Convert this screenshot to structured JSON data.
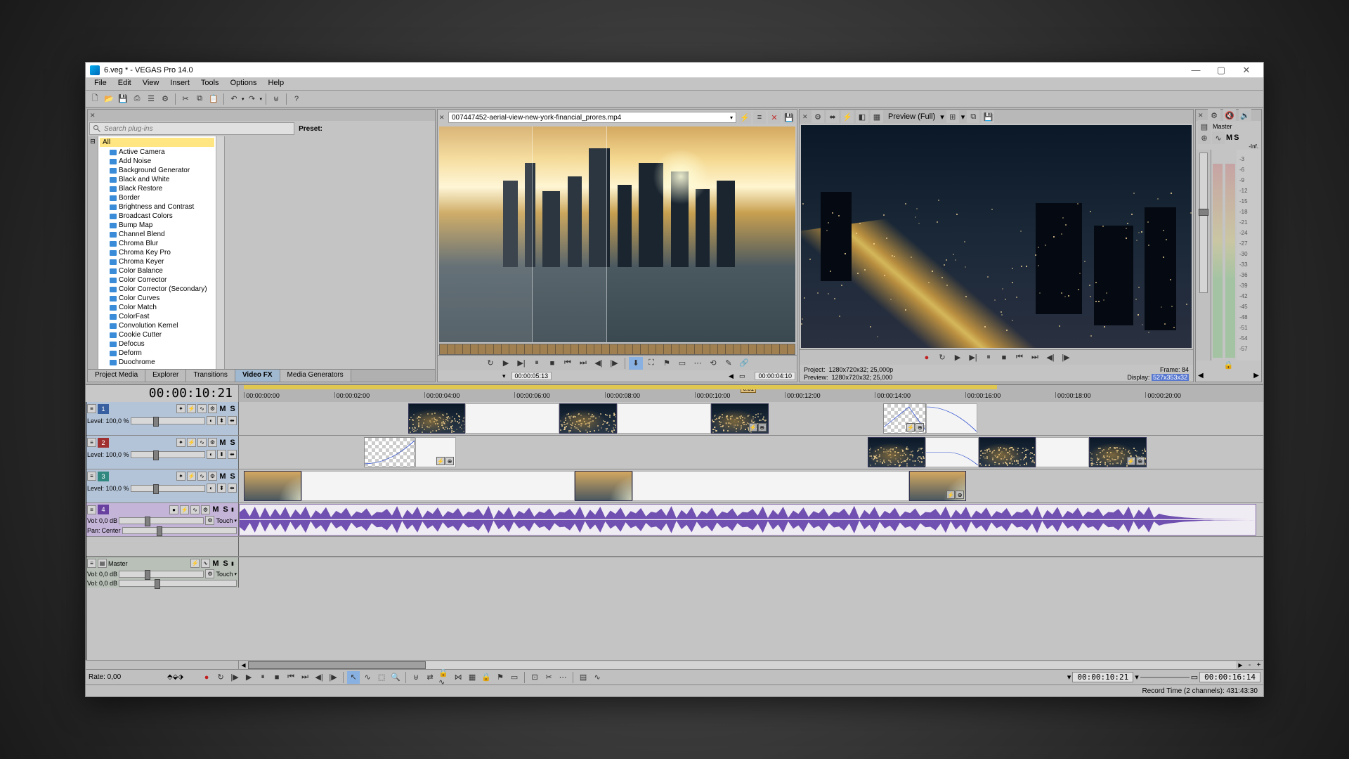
{
  "window": {
    "title": "6.veg * - VEGAS Pro 14.0"
  },
  "menus": [
    "File",
    "Edit",
    "View",
    "Insert",
    "Tools",
    "Options",
    "Help"
  ],
  "fx_panel": {
    "search_placeholder": "Search plug-ins",
    "preset_label": "Preset:",
    "root": "All",
    "items": [
      "Active Camera",
      "Add Noise",
      "Background Generator",
      "Black and White",
      "Black Restore",
      "Border",
      "Brightness and Contrast",
      "Broadcast Colors",
      "Bump Map",
      "Channel Blend",
      "Chroma Blur",
      "Chroma Key Pro",
      "Chroma Keyer",
      "Color Balance",
      "Color Corrector",
      "Color Corrector (Secondary)",
      "Color Curves",
      "Color Match",
      "ColorFast",
      "Convolution Kernel",
      "Cookie Cutter",
      "Defocus",
      "Deform",
      "Duochrome"
    ],
    "tabs": [
      "Project Media",
      "Explorer",
      "Transitions",
      "Video FX",
      "Media Generators"
    ],
    "active_tab": "Video FX"
  },
  "trimmer": {
    "file": "007447452-aerial-view-new-york-financial_prores.mp4",
    "in_tc": "00:00:05:13",
    "len_tc": "00:00:04:10"
  },
  "preview": {
    "quality": "Preview (Full)",
    "project_label": "Project:",
    "project_val": "1280x720x32; 25,000p",
    "preview_label": "Preview:",
    "preview_val": "1280x720x32; 25,000",
    "frame_label": "Frame:",
    "frame_val": "84",
    "display_label": "Display:",
    "display_val": "527x353x32"
  },
  "meter": {
    "label": "Master",
    "inf": "-Inf.",
    "scale": [
      "-3",
      "-6",
      "-9",
      "-12",
      "-15",
      "-18",
      "-21",
      "-24",
      "-27",
      "-30",
      "-33",
      "-36",
      "-39",
      "-42",
      "-45",
      "-48",
      "-51",
      "-54",
      "-57"
    ]
  },
  "timeline": {
    "current_tc": "00:00:10:21",
    "ruler": [
      "00:00:00:00",
      "00:00:02:00",
      "00:00:04:00",
      "00:00:06:00",
      "00:00:08:00",
      "00:00:10:00",
      "00:00:12:00",
      "00:00:14:00",
      "00:00:16:00",
      "00:00:18:00",
      "00:00:20:00"
    ],
    "marker": "6:01",
    "tracks": {
      "v1": {
        "num": "1",
        "level": "Level: 100,0 %",
        "m": "M",
        "s": "S"
      },
      "v2": {
        "num": "2",
        "level": "Level: 100,0 %",
        "m": "M",
        "s": "S"
      },
      "v3": {
        "num": "3",
        "level": "Level: 100,0 %",
        "m": "M",
        "s": "S"
      },
      "a1": {
        "num": "4",
        "vol_label": "Vol:",
        "vol": "0,0 dB",
        "pan_label": "Pan:",
        "pan": "Center",
        "touch": "Touch",
        "m": "M",
        "s": "S"
      },
      "master": {
        "name": "Master",
        "vol_label": "Vol:",
        "vol1": "0,0 dB",
        "vol2": "0,0 dB",
        "touch": "Touch",
        "m": "M",
        "s": "S"
      }
    },
    "rate": "Rate: 0,00",
    "tc_out": "00:00:10:21",
    "tc_len": "00:00:16:14"
  },
  "status": "Record Time (2 channels): 431:43:30"
}
